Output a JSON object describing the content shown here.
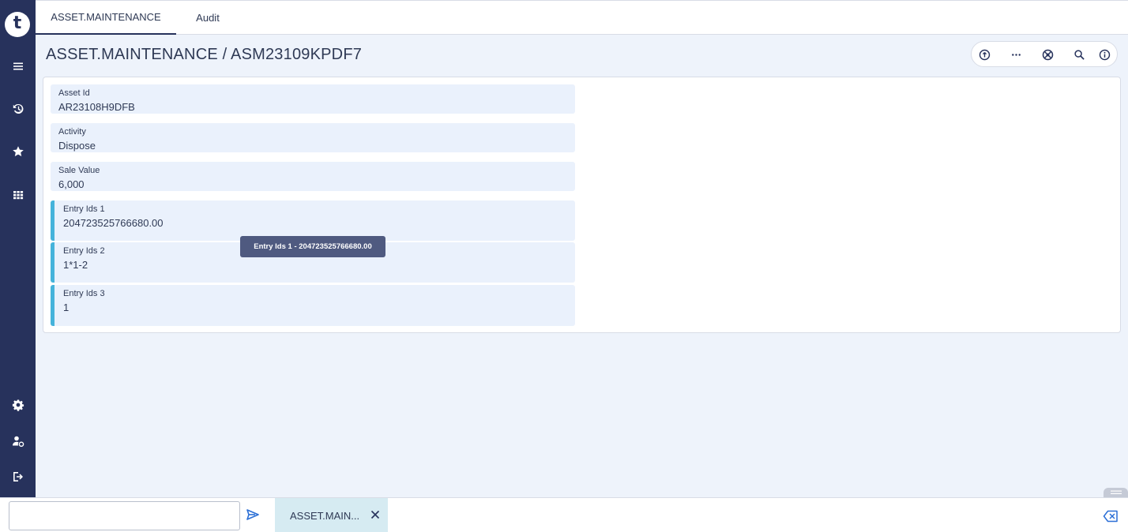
{
  "brand": {
    "logo_letter": "t"
  },
  "sidebar": {
    "items": [
      {
        "name": "menu-icon"
      },
      {
        "name": "history-icon"
      },
      {
        "name": "star-icon"
      },
      {
        "name": "grid-icon"
      },
      {
        "name": "settings-icon"
      },
      {
        "name": "user-settings-icon"
      },
      {
        "name": "logout-icon"
      }
    ]
  },
  "tabs": [
    {
      "label": "ASSET.MAINTENANCE",
      "active": true
    },
    {
      "label": "Audit",
      "active": false
    }
  ],
  "page": {
    "title": "ASSET.MAINTENANCE / ASM23109KPDF7"
  },
  "toolbar": {
    "icons": [
      "add-circle-icon",
      "more-icon",
      "globe-icon",
      "search-icon",
      "info-icon"
    ]
  },
  "fields": [
    {
      "label": "Asset Id",
      "value": "AR23108H9DFB"
    },
    {
      "label": "Activity",
      "value": "Dispose"
    },
    {
      "label": "Sale Value",
      "value": "6,000"
    },
    {
      "label": "Entry Ids 1",
      "value": "204723525766680.00"
    },
    {
      "label": "Entry Ids 2",
      "value": "1*1-2"
    },
    {
      "label": "Entry Ids 3",
      "value": "1"
    }
  ],
  "tooltip": {
    "text": "Entry Ids 1 - 204723525766680.00"
  },
  "bottom": {
    "command_value": "",
    "open_tab_label": "ASSET.MAIN..."
  },
  "colors": {
    "sidebar": "#27325c",
    "accent": "#45b3db",
    "background": "#eef3fb"
  }
}
